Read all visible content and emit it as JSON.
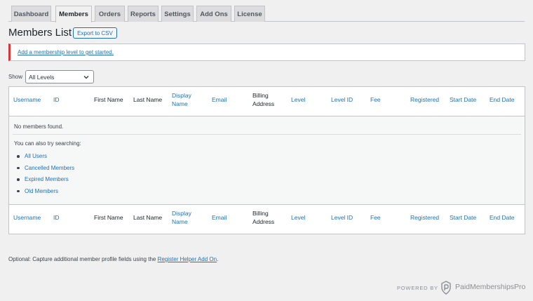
{
  "tabs": [
    "Dashboard",
    "Members",
    "Orders",
    "Reports",
    "Settings",
    "Add Ons",
    "License"
  ],
  "active_tab": "Members",
  "page": {
    "title": "Members List",
    "export_label": "Export to CSV"
  },
  "notice": {
    "link_text": "Add a membership level to get started."
  },
  "filter": {
    "label": "Show",
    "selected": "All Levels"
  },
  "table": {
    "columns": [
      {
        "lines": [
          "Username"
        ],
        "sortable": true
      },
      {
        "lines": [
          "ID"
        ],
        "sortable": true
      },
      {
        "lines": [
          "First Name"
        ],
        "sortable": false
      },
      {
        "lines": [
          "Last Name"
        ],
        "sortable": false
      },
      {
        "lines": [
          "Display",
          "Name"
        ],
        "sortable": true
      },
      {
        "lines": [
          "Email"
        ],
        "sortable": true
      },
      {
        "lines": [
          "Billing",
          "Address"
        ],
        "sortable": false
      },
      {
        "lines": [
          "Level"
        ],
        "sortable": true
      },
      {
        "lines": [
          "Level ID"
        ],
        "sortable": true
      },
      {
        "lines": [
          "Fee"
        ],
        "sortable": true
      },
      {
        "lines": [
          "Registered"
        ],
        "sortable": true
      },
      {
        "lines": [
          "Start Date"
        ],
        "sortable": true
      },
      {
        "lines": [
          "End Date"
        ],
        "sortable": true
      }
    ],
    "empty_message": "No members found.",
    "suggestion_intro": "You can also try searching:",
    "suggestions": [
      "All Users",
      "Cancelled Members",
      "Expired Members",
      "Old Members"
    ]
  },
  "footer": {
    "optional_prefix": "Optional: Capture additional member profile fields using the ",
    "optional_link": "Register Helper Add On",
    "optional_suffix": ".",
    "powered_by": "POWERED BY",
    "brand": "PaidMembershipsPro"
  },
  "colors": {
    "link": "#2271b1",
    "notice_border": "#d63638"
  }
}
